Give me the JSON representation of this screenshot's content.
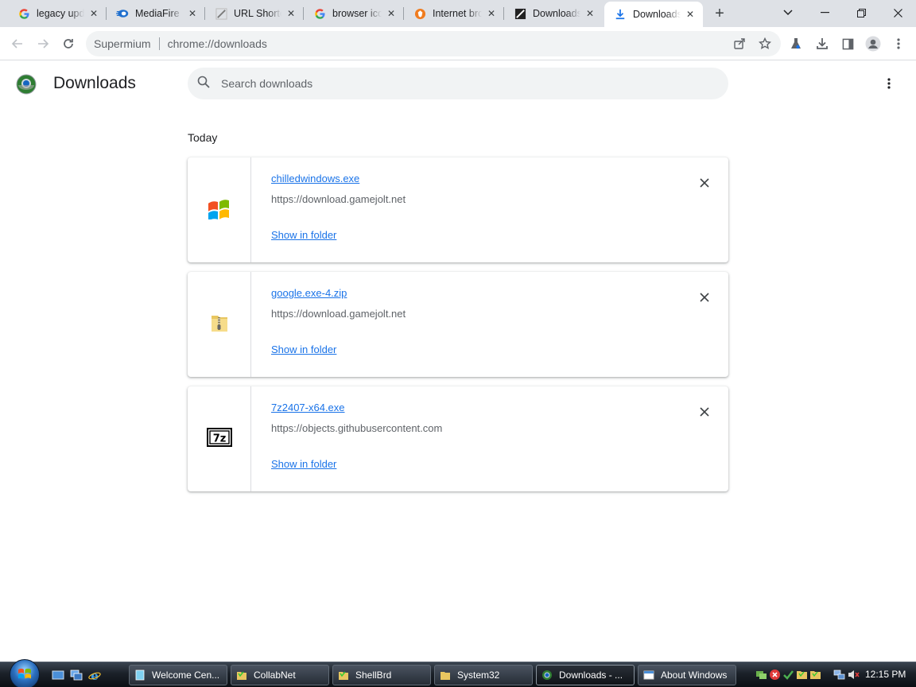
{
  "tabs": [
    {
      "title": "legacy upda",
      "icon": "google-icon"
    },
    {
      "title": "MediaFire",
      "icon": "mediafire-icon"
    },
    {
      "title": "URL Shortener",
      "icon": "link-icon"
    },
    {
      "title": "browser icon",
      "icon": "google-icon"
    },
    {
      "title": "Internet browser",
      "icon": "brave-icon"
    },
    {
      "title": "Downloads",
      "icon": "page-icon"
    },
    {
      "title": "Downloads",
      "icon": "download-icon",
      "active": true
    }
  ],
  "omnibox": {
    "site": "Supermium",
    "url": "chrome://downloads"
  },
  "page": {
    "title": "Downloads",
    "search_placeholder": "Search downloads",
    "section": "Today"
  },
  "downloads": [
    {
      "filename": "chilledwindows.exe",
      "url": "https://download.gamejolt.net",
      "action": "Show in folder",
      "icon": "windows-flag-icon"
    },
    {
      "filename": "google.exe-4.zip",
      "url": "https://download.gamejolt.net",
      "action": "Show in folder",
      "icon": "zip-folder-icon"
    },
    {
      "filename": "7z2407-x64.exe",
      "url": "https://objects.githubusercontent.com",
      "action": "Show in folder",
      "icon": "7zip-icon"
    }
  ],
  "taskbar": {
    "buttons": [
      {
        "label": "Welcome Cen...",
        "active": false
      },
      {
        "label": "CollabNet",
        "active": false
      },
      {
        "label": "ShellBrd",
        "active": false
      },
      {
        "label": "System32",
        "active": false
      },
      {
        "label": "Downloads - ...",
        "active": true
      },
      {
        "label": "About Windows",
        "active": false
      }
    ],
    "clock": "12:15 PM"
  },
  "colors": {
    "accent": "#1a73e8",
    "tabstrip": "#dee1e6",
    "omnibox": "#f1f3f4"
  }
}
